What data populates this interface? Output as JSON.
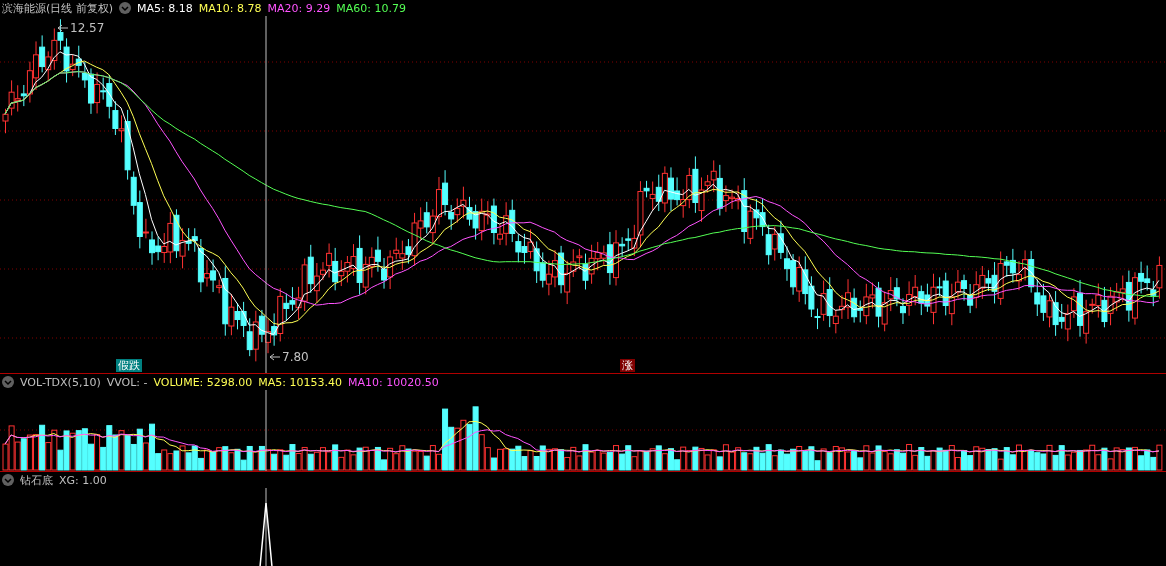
{
  "main": {
    "title": "滨海能源(日线 前复权)",
    "indicators": [
      {
        "label": "MA5: 8.18",
        "color": "#ffffff"
      },
      {
        "label": "MA10: 8.78",
        "color": "#ffff54"
      },
      {
        "label": "MA20: 9.29",
        "color": "#ff54ff"
      },
      {
        "label": "MA60: 10.79",
        "color": "#54ff54"
      }
    ],
    "high_label": "12.57",
    "low_label": "7.80",
    "markers": [
      {
        "text": "假跌",
        "color": "#008080"
      },
      {
        "text": "涨",
        "color": "#800000"
      }
    ]
  },
  "volume": {
    "title": "VOL-TDX(5,10)",
    "items": [
      {
        "label": "VVOL: -",
        "color": "#c0c0c0"
      },
      {
        "label": "VOLUME: 5298.00",
        "color": "#ffff54"
      },
      {
        "label": "MA5: 10153.40",
        "color": "#ffff54"
      },
      {
        "label": "MA10: 10020.50",
        "color": "#ff54ff"
      }
    ]
  },
  "signal": {
    "title": "钻石底",
    "items": [
      {
        "label": "XG: 1.00",
        "color": "#c0c0c0"
      }
    ]
  }
}
